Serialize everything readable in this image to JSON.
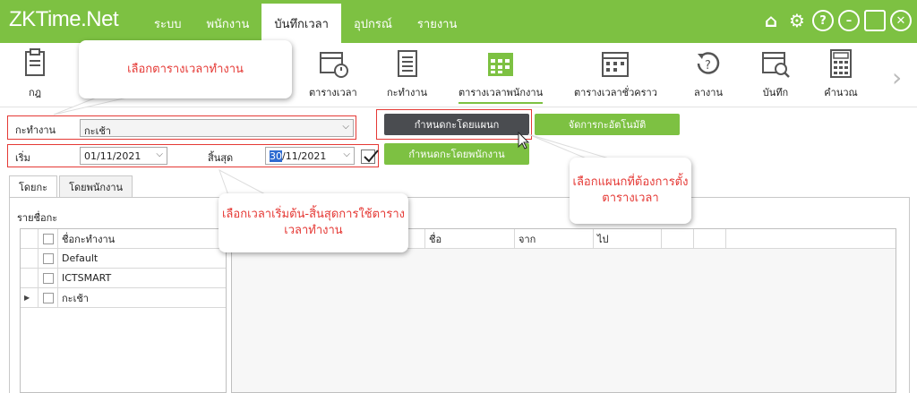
{
  "app": {
    "logo": "ZKTime.Net"
  },
  "menu": [
    {
      "label": "ระบบ"
    },
    {
      "label": "พนักงาน"
    },
    {
      "label": "บันทึกเวลา",
      "active": true
    },
    {
      "label": "อุปกรณ์"
    },
    {
      "label": "รายงาน"
    }
  ],
  "window_controls": {
    "home": "⌂",
    "settings": "⚙",
    "help": "?",
    "minimize": "–",
    "maximize": "□",
    "close": "✕"
  },
  "toolbar": {
    "items": [
      {
        "label": "กฎ",
        "icon": "clipboard-icon"
      },
      {
        "label": "ตารางเวลา",
        "icon": "timetable-icon"
      },
      {
        "label": "กะทำงาน",
        "icon": "notepad-icon"
      },
      {
        "label": "ตารางเวลาพนักงาน",
        "icon": "calendar-icon",
        "active": true
      },
      {
        "label": "ตารางเวลาชั่วคราว",
        "icon": "temp-calendar-icon"
      },
      {
        "label": "ลางาน",
        "icon": "leave-icon"
      },
      {
        "label": "บันทึก",
        "icon": "record-icon"
      },
      {
        "label": "คำนวณ",
        "icon": "calculator-icon"
      }
    ]
  },
  "callouts": {
    "select_schedule": "เลือกตารางเวลาทำงาน",
    "select_dept": "เลือกแผนกที่ต้องการตั้งตารางเวลา",
    "select_dates": "เลือกเวลาเริ่มต้น-สิ้นสุดการใช้ตารางเวลาทำงาน"
  },
  "form": {
    "shift_label": "กะทำงาน",
    "shift_value": "กะเช้า",
    "start_label": "เริ่ม",
    "start_value": "01/11/2021",
    "end_label": "สิ้นสุด",
    "end_day": "30",
    "end_rest": "/11/2021"
  },
  "buttons": {
    "by_department": "กำหนดกะโดยแผนก",
    "auto_shift": "จัดการกะอัตโนมัติ",
    "by_employee": "กำหนดกะโดยพนักงาน"
  },
  "tabs": [
    {
      "label": "โดยกะ",
      "active": true
    },
    {
      "label": "โดยพนักงาน"
    }
  ],
  "left_grid": {
    "title": "รายชื่อกะ",
    "header": "ชื่อกะทำงาน",
    "rows": [
      "Default",
      "ICTSMART",
      "กะเช้า"
    ]
  },
  "right_grid": {
    "headers": [
      "ชื่อ",
      "จาก",
      "ไป"
    ]
  },
  "colors": {
    "brand_green": "#7dc142",
    "accent_red": "#e53935",
    "dark_button": "#4a4c50"
  }
}
